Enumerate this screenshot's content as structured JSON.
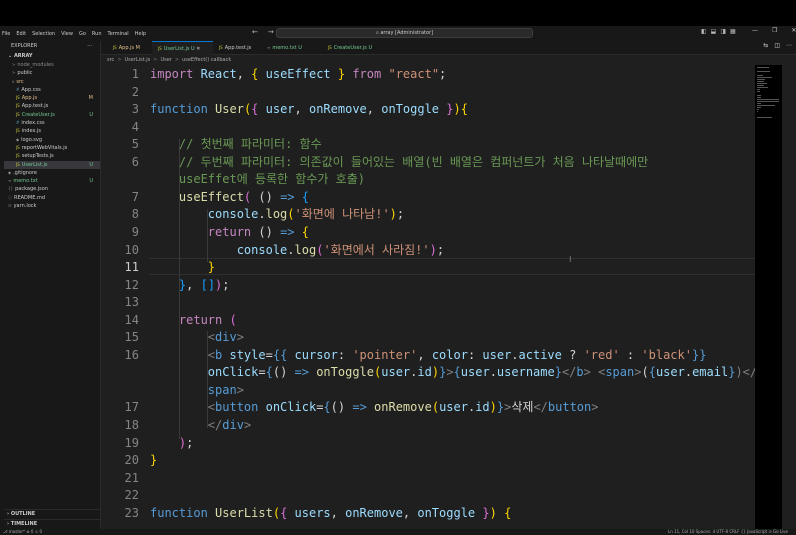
{
  "menu": [
    "File",
    "Edit",
    "Selection",
    "View",
    "Go",
    "Run",
    "Terminal",
    "Help"
  ],
  "search": "array [Administrator]",
  "explorer": {
    "title": "EXPLORER",
    "more": "···",
    "root": "ARRAY",
    "items": [
      {
        "name": "node_modules",
        "status": "",
        "color": "#8b8b8b",
        "icon": ">"
      },
      {
        "name": "public",
        "status": "",
        "color": "#cccccc",
        "icon": ">"
      },
      {
        "name": "src",
        "status": "",
        "color": "#e2c08d",
        "icon": "v"
      },
      {
        "name": "App.css",
        "status": "",
        "color": "#cccccc",
        "icon": "#"
      },
      {
        "name": "App.js",
        "status": "M",
        "color": "#e2c08d",
        "icon": "JS"
      },
      {
        "name": "App.test.js",
        "status": "",
        "color": "#cccccc",
        "icon": "JS"
      },
      {
        "name": "CreateUser.js",
        "status": "U",
        "color": "#73c991",
        "icon": "JS"
      },
      {
        "name": "index.css",
        "status": "",
        "color": "#cccccc",
        "icon": "#"
      },
      {
        "name": "index.js",
        "status": "",
        "color": "#cccccc",
        "icon": "JS"
      },
      {
        "name": "logo.svg",
        "status": "",
        "color": "#cccccc",
        "icon": "◆"
      },
      {
        "name": "reportWebVitals.js",
        "status": "",
        "color": "#cccccc",
        "icon": "JS"
      },
      {
        "name": "setupTests.js",
        "status": "",
        "color": "#cccccc",
        "icon": "JS"
      },
      {
        "name": "UserList.js",
        "status": "U",
        "color": "#73c991",
        "icon": "JS"
      },
      {
        "name": ".gitignore",
        "status": "",
        "color": "#cccccc",
        "icon": "◆"
      },
      {
        "name": "memo.txt",
        "status": "U",
        "color": "#73c991",
        "icon": "≡"
      },
      {
        "name": "package.json",
        "status": "",
        "color": "#cccccc",
        "icon": "{}"
      },
      {
        "name": "README.md",
        "status": "",
        "color": "#cccccc",
        "icon": "ⓘ"
      },
      {
        "name": "yarn.lock",
        "status": "",
        "color": "#cccccc",
        "icon": "☷"
      }
    ],
    "outline": "OUTLINE",
    "timeline": "TIMELINE"
  },
  "tabs": [
    {
      "label": "App.js",
      "mark": "M",
      "color": "#e2c08d",
      "icon": "JS",
      "active": false
    },
    {
      "label": "UserList.js",
      "mark": "U",
      "color": "#73c991",
      "icon": "JS",
      "active": true
    },
    {
      "label": "App.test.js",
      "mark": "",
      "color": "#cccccc",
      "icon": "JS",
      "active": false
    },
    {
      "label": "memo.txt",
      "mark": "U",
      "color": "#73c991",
      "icon": "≡",
      "active": false
    },
    {
      "label": "CreateUser.js",
      "mark": "U",
      "color": "#73c991",
      "icon": "JS",
      "active": false
    }
  ],
  "breadcrumb": [
    "src",
    ">",
    "UserList.js",
    ">",
    "User",
    ">",
    "useEffect() callback"
  ],
  "code": [
    {
      "n": "1",
      "segs": [
        [
          "import ",
          "k"
        ],
        [
          "React",
          "v"
        ],
        [
          ", ",
          "w"
        ],
        [
          "{",
          "y"
        ],
        [
          " useEffect ",
          "v"
        ],
        [
          "}",
          "y"
        ],
        [
          " from ",
          "k"
        ],
        [
          "\"react\"",
          "s"
        ],
        [
          ";",
          "w"
        ]
      ]
    },
    {
      "n": "2",
      "segs": []
    },
    {
      "n": "3",
      "segs": [
        [
          "function ",
          "kb"
        ],
        [
          "User",
          "f"
        ],
        [
          "(",
          "y"
        ],
        [
          "{",
          "p"
        ],
        [
          " user",
          "v"
        ],
        [
          ", ",
          "w"
        ],
        [
          "onRemove",
          "v"
        ],
        [
          ", ",
          "w"
        ],
        [
          "onToggle ",
          "v"
        ],
        [
          "}",
          "p"
        ],
        [
          ")",
          "y"
        ],
        [
          "{",
          "y"
        ]
      ]
    },
    {
      "n": "4",
      "segs": []
    },
    {
      "n": "5",
      "segs": [
        [
          "    // 첫번째 파라미터: 함수",
          "c"
        ]
      ]
    },
    {
      "n": "6",
      "segs": [
        [
          "    // 두번째 파라미터: 의존값이 들어있는 배열(빈 배열은 컴퍼넌트가 처음 나타날때에만",
          "c"
        ]
      ]
    },
    {
      "n": "",
      "segs": [
        [
          "    useEffet에 등록한 함수가 호출)",
          "c"
        ]
      ]
    },
    {
      "n": "7",
      "segs": [
        [
          "    useEffect",
          "f"
        ],
        [
          "(",
          "p"
        ],
        [
          " () ",
          "w"
        ],
        [
          "=>",
          "kb"
        ],
        [
          " {",
          "b"
        ]
      ]
    },
    {
      "n": "8",
      "segs": [
        [
          "        console",
          "v"
        ],
        [
          ".",
          "w"
        ],
        [
          "log",
          "f"
        ],
        [
          "(",
          "y"
        ],
        [
          "'화면에 나타남!'",
          "s"
        ],
        [
          ")",
          "y"
        ],
        [
          ";",
          "w"
        ]
      ]
    },
    {
      "n": "9",
      "segs": [
        [
          "        return ",
          "k"
        ],
        [
          "() ",
          "w"
        ],
        [
          "=>",
          "kb"
        ],
        [
          " ",
          "w"
        ],
        [
          "{",
          "y"
        ]
      ]
    },
    {
      "n": "10",
      "segs": [
        [
          "            console",
          "v"
        ],
        [
          ".",
          "w"
        ],
        [
          "log",
          "f"
        ],
        [
          "(",
          "p"
        ],
        [
          "'화면에서 사라짐!'",
          "s"
        ],
        [
          ")",
          "p"
        ],
        [
          ";",
          "w"
        ]
      ]
    },
    {
      "n": "11",
      "segs": [
        [
          "        ",
          "w"
        ],
        [
          "}",
          "y"
        ]
      ]
    },
    {
      "n": "12",
      "segs": [
        [
          "    ",
          "w"
        ],
        [
          "}",
          "b"
        ],
        [
          ", ",
          "w"
        ],
        [
          "[]",
          "b"
        ],
        [
          ")",
          "p"
        ],
        [
          ";",
          "w"
        ]
      ]
    },
    {
      "n": "13",
      "segs": []
    },
    {
      "n": "14",
      "segs": [
        [
          "    return ",
          "k"
        ],
        [
          "(",
          "p"
        ]
      ]
    },
    {
      "n": "15",
      "segs": [
        [
          "        <",
          "g"
        ],
        [
          "div",
          "kb"
        ],
        [
          ">",
          "g"
        ]
      ]
    },
    {
      "n": "16",
      "segs": [
        [
          "        <",
          "g"
        ],
        [
          "b ",
          "kb"
        ],
        [
          "style",
          "v"
        ],
        [
          "=",
          "w"
        ],
        [
          "{{",
          "kb"
        ],
        [
          " cursor",
          "v"
        ],
        [
          ": ",
          "w"
        ],
        [
          "'pointer'",
          "s"
        ],
        [
          ", ",
          "w"
        ],
        [
          "color",
          "v"
        ],
        [
          ": ",
          "w"
        ],
        [
          "user",
          "v"
        ],
        [
          ".",
          "w"
        ],
        [
          "active",
          "v"
        ],
        [
          " ? ",
          "w"
        ],
        [
          "'red'",
          "s"
        ],
        [
          " : ",
          "w"
        ],
        [
          "'black'",
          "s"
        ],
        [
          "}}",
          "kb"
        ]
      ]
    },
    {
      "n": "",
      "segs": [
        [
          "        onClick",
          "v"
        ],
        [
          "=",
          "w"
        ],
        [
          "{",
          "kb"
        ],
        [
          "() ",
          "w"
        ],
        [
          "=>",
          "kb"
        ],
        [
          " onToggle",
          "f"
        ],
        [
          "(",
          "y"
        ],
        [
          "user",
          "v"
        ],
        [
          ".",
          "w"
        ],
        [
          "id",
          "v"
        ],
        [
          ")",
          "y"
        ],
        [
          "}",
          "kb"
        ],
        [
          ">",
          "g"
        ],
        [
          "{",
          "kb"
        ],
        [
          "user",
          "v"
        ],
        [
          ".",
          "w"
        ],
        [
          "username",
          "v"
        ],
        [
          "}",
          "kb"
        ],
        [
          "</",
          "g"
        ],
        [
          "b",
          "kb"
        ],
        [
          ">",
          "g"
        ],
        [
          " <",
          "g"
        ],
        [
          "span",
          "kb"
        ],
        [
          ">",
          "g"
        ],
        [
          "(",
          "w"
        ],
        [
          "{",
          "kb"
        ],
        [
          "user",
          "v"
        ],
        [
          ".",
          "w"
        ],
        [
          "email",
          "v"
        ],
        [
          "}",
          "kb"
        ],
        [
          ")</",
          "g"
        ]
      ]
    },
    {
      "n": "",
      "segs": [
        [
          "        span",
          "kb"
        ],
        [
          ">",
          "g"
        ]
      ]
    },
    {
      "n": "17",
      "segs": [
        [
          "        <",
          "g"
        ],
        [
          "button ",
          "kb"
        ],
        [
          "onClick",
          "v"
        ],
        [
          "=",
          "w"
        ],
        [
          "{",
          "kb"
        ],
        [
          "() ",
          "w"
        ],
        [
          "=>",
          "kb"
        ],
        [
          " onRemove",
          "f"
        ],
        [
          "(",
          "y"
        ],
        [
          "user",
          "v"
        ],
        [
          ".",
          "w"
        ],
        [
          "id",
          "v"
        ],
        [
          ")",
          "y"
        ],
        [
          "}",
          "kb"
        ],
        [
          ">",
          "g"
        ],
        [
          "삭제",
          "w"
        ],
        [
          "</",
          "g"
        ],
        [
          "button",
          "kb"
        ],
        [
          ">",
          "g"
        ]
      ]
    },
    {
      "n": "18",
      "segs": [
        [
          "        </",
          "g"
        ],
        [
          "div",
          "kb"
        ],
        [
          ">",
          "g"
        ]
      ]
    },
    {
      "n": "19",
      "segs": [
        [
          "    ",
          "w"
        ],
        [
          ")",
          "p"
        ],
        [
          ";",
          "w"
        ]
      ]
    },
    {
      "n": "20",
      "segs": [
        [
          "}",
          "y"
        ]
      ]
    },
    {
      "n": "21",
      "segs": []
    },
    {
      "n": "22",
      "segs": []
    },
    {
      "n": "23",
      "segs": [
        [
          "function ",
          "kb"
        ],
        [
          "UserList",
          "f"
        ],
        [
          "(",
          "y"
        ],
        [
          "{",
          "p"
        ],
        [
          " users",
          "v"
        ],
        [
          ", ",
          "w"
        ],
        [
          "onRemove",
          "v"
        ],
        [
          ", ",
          "w"
        ],
        [
          "onToggle ",
          "v"
        ],
        [
          "}",
          "p"
        ],
        [
          ")",
          "y"
        ],
        [
          " {",
          "y"
        ]
      ]
    }
  ],
  "current_line": "11",
  "status": {
    "left": "⎇ master*  ⊗ 0 ⚠ 0",
    "right": "Ln 11, Col 10   Spaces: 4   UTF-8   CRLF   {} JavaScript   ⊙ Go Live"
  }
}
